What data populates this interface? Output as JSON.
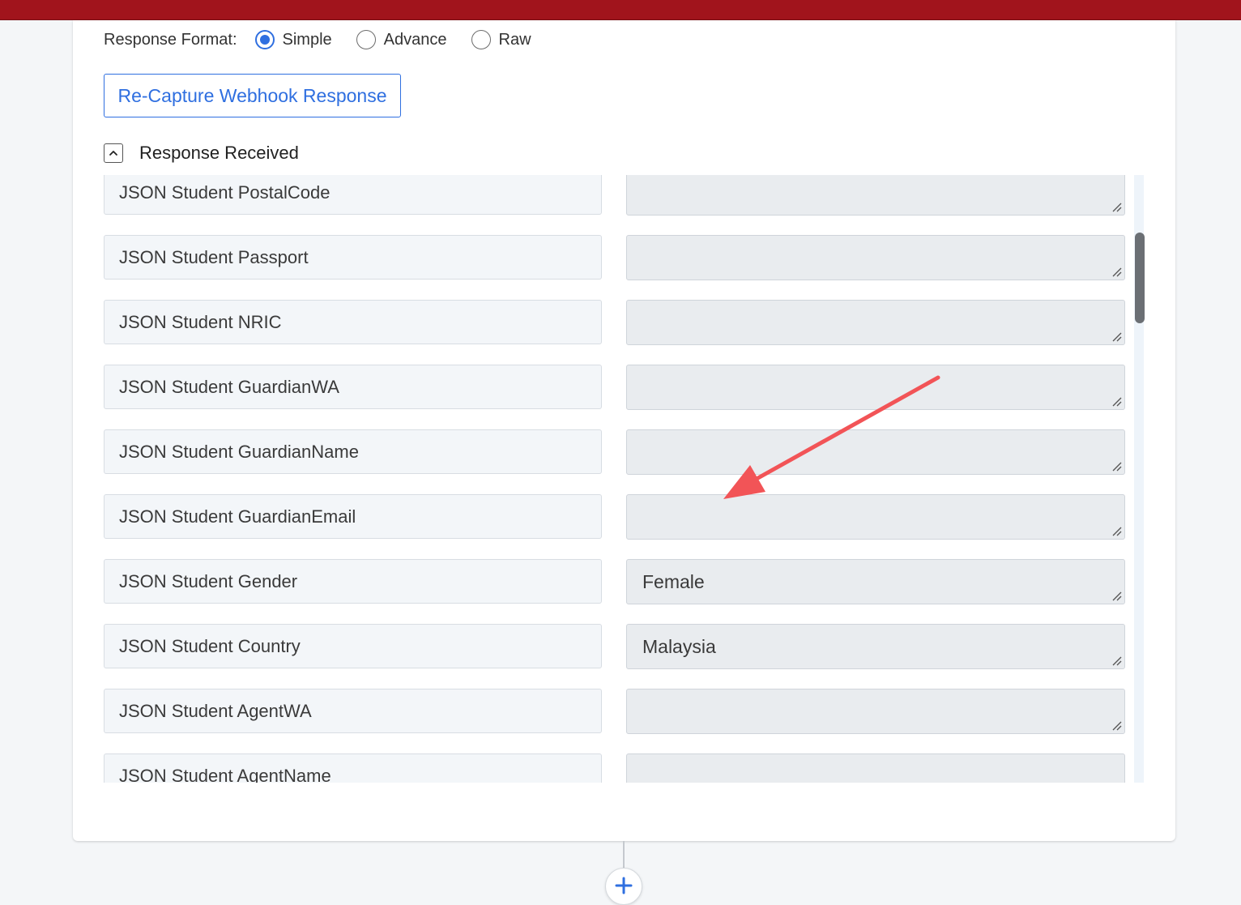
{
  "response_format": {
    "label": "Response Format:",
    "options": [
      {
        "label": "Simple",
        "checked": true
      },
      {
        "label": "Advance",
        "checked": false
      },
      {
        "label": "Raw",
        "checked": false
      }
    ]
  },
  "recapture_button": {
    "label": "Re-Capture Webhook Response"
  },
  "response_section": {
    "title": "Response Received",
    "collapse_icon": "chevron-up-icon"
  },
  "fields": [
    {
      "name": "JSON Student PostalCode",
      "value": ""
    },
    {
      "name": "JSON Student Passport",
      "value": ""
    },
    {
      "name": "JSON Student NRIC",
      "value": ""
    },
    {
      "name": "JSON Student GuardianWA",
      "value": ""
    },
    {
      "name": "JSON Student GuardianName",
      "value": ""
    },
    {
      "name": "JSON Student GuardianEmail",
      "value": ""
    },
    {
      "name": "JSON Student Gender",
      "value": "Female"
    },
    {
      "name": "JSON Student Country",
      "value": "Malaysia"
    },
    {
      "name": "JSON Student AgentWA",
      "value": ""
    },
    {
      "name": "JSON Student AgentName",
      "value": ""
    }
  ],
  "add_step": {
    "icon": "plus-icon"
  },
  "colors": {
    "top_bar": "#a1141c",
    "accent": "#2f6fe0",
    "annotation_arrow": "#f25457"
  }
}
